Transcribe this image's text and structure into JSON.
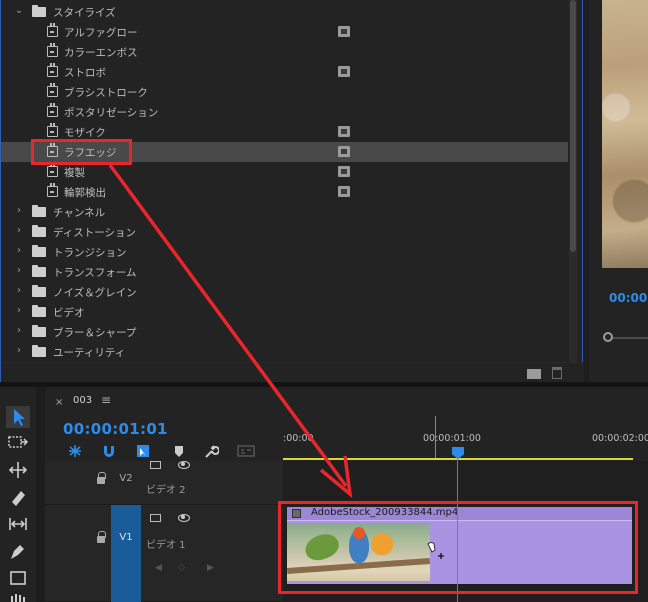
{
  "effects": {
    "rows": [
      {
        "kind": "folder",
        "open": true,
        "label": "スタイライズ",
        "sel": false,
        "badge": false
      },
      {
        "kind": "effect",
        "label": "アルファグロー",
        "sel": false,
        "badge": true
      },
      {
        "kind": "effect",
        "label": "カラーエンボス",
        "sel": false,
        "badge": false
      },
      {
        "kind": "effect",
        "label": "ストロボ",
        "sel": false,
        "badge": true
      },
      {
        "kind": "effect",
        "label": "ブラシストローク",
        "sel": false,
        "badge": false
      },
      {
        "kind": "effect",
        "label": "ポスタリゼーション",
        "sel": false,
        "badge": false
      },
      {
        "kind": "effect",
        "label": "モザイク",
        "sel": false,
        "badge": true
      },
      {
        "kind": "effect",
        "label": "ラフエッジ",
        "sel": true,
        "badge": true
      },
      {
        "kind": "effect",
        "label": "複製",
        "sel": false,
        "badge": true
      },
      {
        "kind": "effect",
        "label": "輪郭検出",
        "sel": false,
        "badge": true
      },
      {
        "kind": "folder",
        "open": false,
        "label": "チャンネル",
        "sel": false,
        "badge": false
      },
      {
        "kind": "folder",
        "open": false,
        "label": "ディストーション",
        "sel": false,
        "badge": false
      },
      {
        "kind": "folder",
        "open": false,
        "label": "トランジション",
        "sel": false,
        "badge": false
      },
      {
        "kind": "folder",
        "open": false,
        "label": "トランスフォーム",
        "sel": false,
        "badge": false
      },
      {
        "kind": "folder",
        "open": false,
        "label": "ノイズ＆グレイン",
        "sel": false,
        "badge": false
      },
      {
        "kind": "folder",
        "open": false,
        "label": "ビデオ",
        "sel": false,
        "badge": false
      },
      {
        "kind": "folder",
        "open": false,
        "label": "ブラー＆シャープ",
        "sel": false,
        "badge": false
      },
      {
        "kind": "folder",
        "open": false,
        "label": "ユーティリティ",
        "sel": false,
        "badge": false
      }
    ]
  },
  "monitor": {
    "timecode": "00:00"
  },
  "timeline": {
    "sequence_name": "003",
    "timecode": "00:00:01:01",
    "ruler_labels": [
      ":00:00",
      "00:00:01:00",
      "00:00:02:00"
    ],
    "tracks": {
      "v2": {
        "id": "V2",
        "name": "ビデオ 2"
      },
      "v1": {
        "id": "V1",
        "name": "ビデオ 1"
      }
    },
    "clip": {
      "name": "AdobeStock_200933844.mp4"
    }
  },
  "colors": {
    "accent": "#2d8ceb",
    "highlight": "#e8262c",
    "clip": "#a993e2"
  },
  "icons": [
    "selection-tool-icon",
    "track-select-icon",
    "ripple-edit-icon",
    "razor-icon",
    "slip-icon",
    "pen-icon",
    "rectangle-icon",
    "hand-icon",
    "snap-icon",
    "linked-selection-icon",
    "add-marker-icon",
    "wrench-icon",
    "captions-icon",
    "lock-icon",
    "eye-icon",
    "camera-icon",
    "folder-icon",
    "fx-icon",
    "trash-icon"
  ]
}
